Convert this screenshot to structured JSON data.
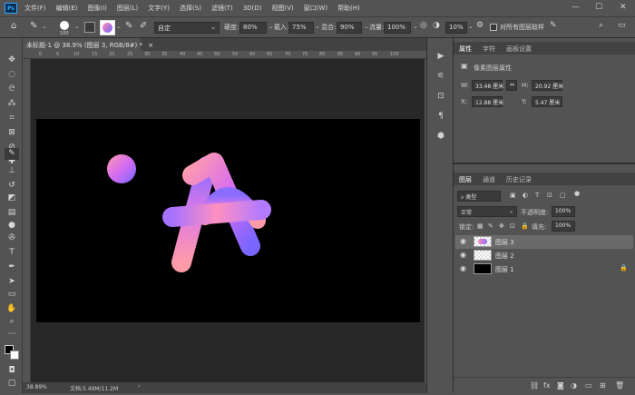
{
  "app": {
    "logo": "Ps"
  },
  "menu": [
    "文件(F)",
    "编辑(E)",
    "图像(I)",
    "图层(L)",
    "文字(Y)",
    "选择(S)",
    "滤镜(T)",
    "3D(D)",
    "视图(V)",
    "窗口(W)",
    "帮助(H)"
  ],
  "window_controls": {
    "minimize": "—",
    "maximize": "☐",
    "close": "✕"
  },
  "options": {
    "brush_size": "100",
    "mode_value": "自定",
    "opacity_label": "硬度:",
    "opacity_value": "80%",
    "flow_label": "载入:",
    "flow_value": "75%",
    "mix_label": "混合:",
    "mix_value": "90%",
    "rate_label": "流量:",
    "rate_value": "100%",
    "smooth_value": "10%",
    "sample_all_label": "对所有图层取样"
  },
  "document": {
    "tab_title": "未标题-1 @ 38.9% (图层 3, RGB/8#) *",
    "close": "×"
  },
  "ruler": {
    "marks": [
      "0",
      "5",
      "10",
      "15",
      "20",
      "25",
      "30",
      "35",
      "40",
      "45",
      "50",
      "55",
      "60",
      "65",
      "70",
      "75",
      "80",
      "85",
      "90",
      "95",
      "100"
    ]
  },
  "status": {
    "zoom": "38.89%",
    "doc_info": "文档:5.49M/11.2M",
    "arrow": "›"
  },
  "properties": {
    "tabs": [
      "属性",
      "字符",
      "画板设置"
    ],
    "title": "像素图层属性",
    "w_label": "W:",
    "w_value": "33.48 厘米",
    "h_label": "H:",
    "h_value": "20.92 厘米",
    "x_label": "X:",
    "x_value": "12.88 厘米",
    "y_label": "Y:",
    "y_value": "5.47 厘米",
    "link_icon": "⇔"
  },
  "layers_panel": {
    "tabs": [
      "图层",
      "通道",
      "历史记录"
    ],
    "filter_label": "类型",
    "blend_mode": "正常",
    "opacity_label": "不透明度:",
    "opacity_value": "100%",
    "lock_label": "锁定:",
    "fill_label": "填充:",
    "fill_value": "100%",
    "layers": [
      {
        "name": "图层 3",
        "selected": true
      },
      {
        "name": "图层 2",
        "selected": false
      },
      {
        "name": "图层 1",
        "selected": false
      }
    ],
    "bottom_icons": [
      "link-icon",
      "fx-icon",
      "mask-icon",
      "adjustment-icon",
      "group-icon",
      "new-layer-icon",
      "trash-icon"
    ]
  },
  "artwork": {
    "gradient": [
      "#ff8ab4",
      "#c46cf0",
      "#7a64ff"
    ]
  }
}
